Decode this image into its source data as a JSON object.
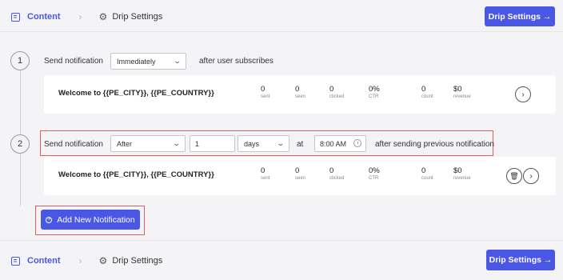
{
  "breadcrumb": {
    "content_label": "Content",
    "drip_label": "Drip Settings",
    "chevron": "›",
    "gear": "⚙"
  },
  "header": {
    "button_label": "Drip Settings →"
  },
  "footer": {
    "button_label": "Drip Settings →"
  },
  "steps": [
    {
      "number": "1",
      "send_label": "Send notification",
      "timing_select": "Immediately",
      "suffix": "after user subscribes",
      "card": {
        "title": "Welcome to {{PE_CITY}}, {{PE_COUNTRY}}",
        "stats": [
          {
            "value": "0",
            "label": "sent"
          },
          {
            "value": "0",
            "label": "seen"
          },
          {
            "value": "0",
            "label": "clicked"
          },
          {
            "value": "0%",
            "label": "CTR"
          },
          {
            "value": "0",
            "label": "count"
          },
          {
            "value": "$0",
            "label": "revenue"
          }
        ]
      }
    },
    {
      "number": "2",
      "send_label": "Send notification",
      "timing_select": "After",
      "delay_value": "1",
      "unit_select": "days",
      "at_label": "at",
      "time_value": "8:00 AM",
      "suffix": "after sending previous notification",
      "card": {
        "title": "Welcome to {{PE_CITY}}, {{PE_COUNTRY}}",
        "stats": [
          {
            "value": "0",
            "label": "sent"
          },
          {
            "value": "0",
            "label": "seen"
          },
          {
            "value": "0",
            "label": "clicked"
          },
          {
            "value": "0%",
            "label": "CTR"
          },
          {
            "value": "0",
            "label": "count"
          },
          {
            "value": "$0",
            "label": "revenue"
          }
        ]
      }
    }
  ],
  "add_button_label": "Add New Notification",
  "colors": {
    "accent": "#4a57e5",
    "highlight": "#e35d5d",
    "background": "#f4f4f7"
  },
  "icons": [
    "content-icon",
    "chevron-right-icon",
    "gear-icon",
    "chevron-down-icon",
    "clock-icon",
    "trash-icon",
    "arrow-right-circle-icon",
    "plus-circle-icon"
  ]
}
